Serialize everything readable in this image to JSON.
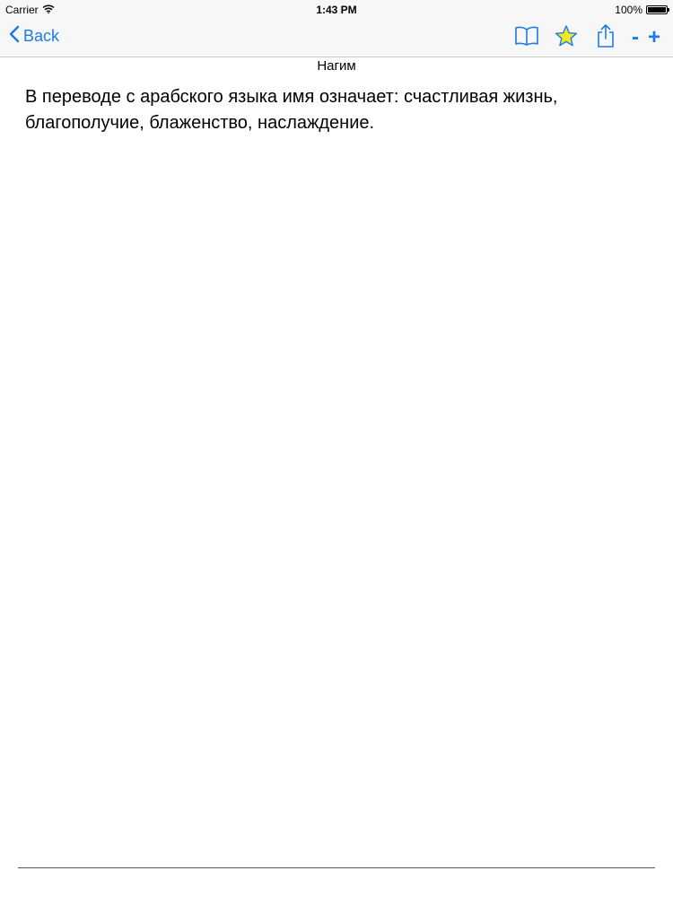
{
  "status_bar": {
    "carrier": "Carrier",
    "time": "1:43 PM",
    "battery_percent": "100%",
    "battery_level": 1.0
  },
  "nav": {
    "back_label": "Back",
    "icons": [
      "chevron-left-icon",
      "book-icon",
      "star-icon",
      "share-icon"
    ],
    "zoom_out_label": "-",
    "zoom_in_label": "+",
    "accent_color": "#1a7ce6",
    "star_color": "#f5e62a"
  },
  "page": {
    "title": "Нагим",
    "body": "В переводе с арабского языка имя означает: счастливая жизнь, благополучие, блаженство, наслаждение."
  }
}
